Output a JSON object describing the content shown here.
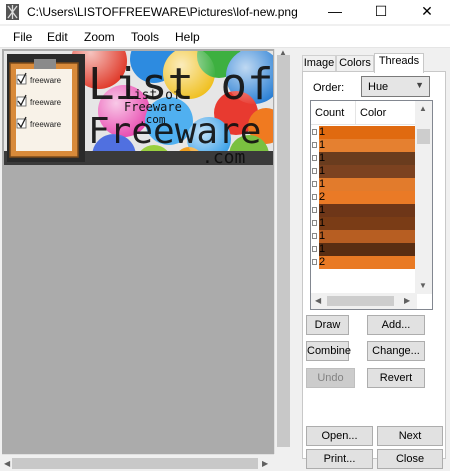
{
  "window": {
    "title": "C:\\Users\\LISTOFFREEWARE\\Pictures\\lof-new.png - Ryijy S...",
    "minimize": "—",
    "maximize": "☐",
    "close": "✕"
  },
  "menu": [
    "File",
    "Edit",
    "Zoom",
    "Tools",
    "Help"
  ],
  "image": {
    "logo_line1": "List of",
    "logo_line2": "Freeware",
    "logo_line3": ".com",
    "small_line1": "List of",
    "small_line2": "Freeware",
    "small_line3": ".com",
    "checklist": [
      "freeware",
      "freeware",
      "freeware"
    ]
  },
  "tabs": [
    "Image",
    "Colors",
    "Threads"
  ],
  "active_tab": "Threads",
  "threads": {
    "order_label": "Order:",
    "order_value": "Hue",
    "columns": [
      "Count",
      "Color"
    ],
    "rows": [
      {
        "count": "1",
        "color": "#e06a10"
      },
      {
        "count": "1",
        "color": "#e58030"
      },
      {
        "count": "1",
        "color": "#6a3c1e"
      },
      {
        "count": "1",
        "color": "#7c4220"
      },
      {
        "count": "1",
        "color": "#e27b2c"
      },
      {
        "count": "2",
        "color": "#ea7a26"
      },
      {
        "count": "1",
        "color": "#6e3618"
      },
      {
        "count": "1",
        "color": "#7a3c16"
      },
      {
        "count": "1",
        "color": "#b75e22"
      },
      {
        "count": "1",
        "color": "#5a2e12"
      },
      {
        "count": "2",
        "color": "#e97a24"
      }
    ]
  },
  "buttons": {
    "draw": "Draw",
    "add": "Add...",
    "combine": "Combine",
    "change": "Change...",
    "undo": "Undo",
    "revert": "Revert",
    "open": "Open...",
    "next": "Next",
    "print": "Print...",
    "close": "Close"
  },
  "colors": {
    "canvas_bg": "#ababab",
    "accent_orange": "#e06a10"
  }
}
